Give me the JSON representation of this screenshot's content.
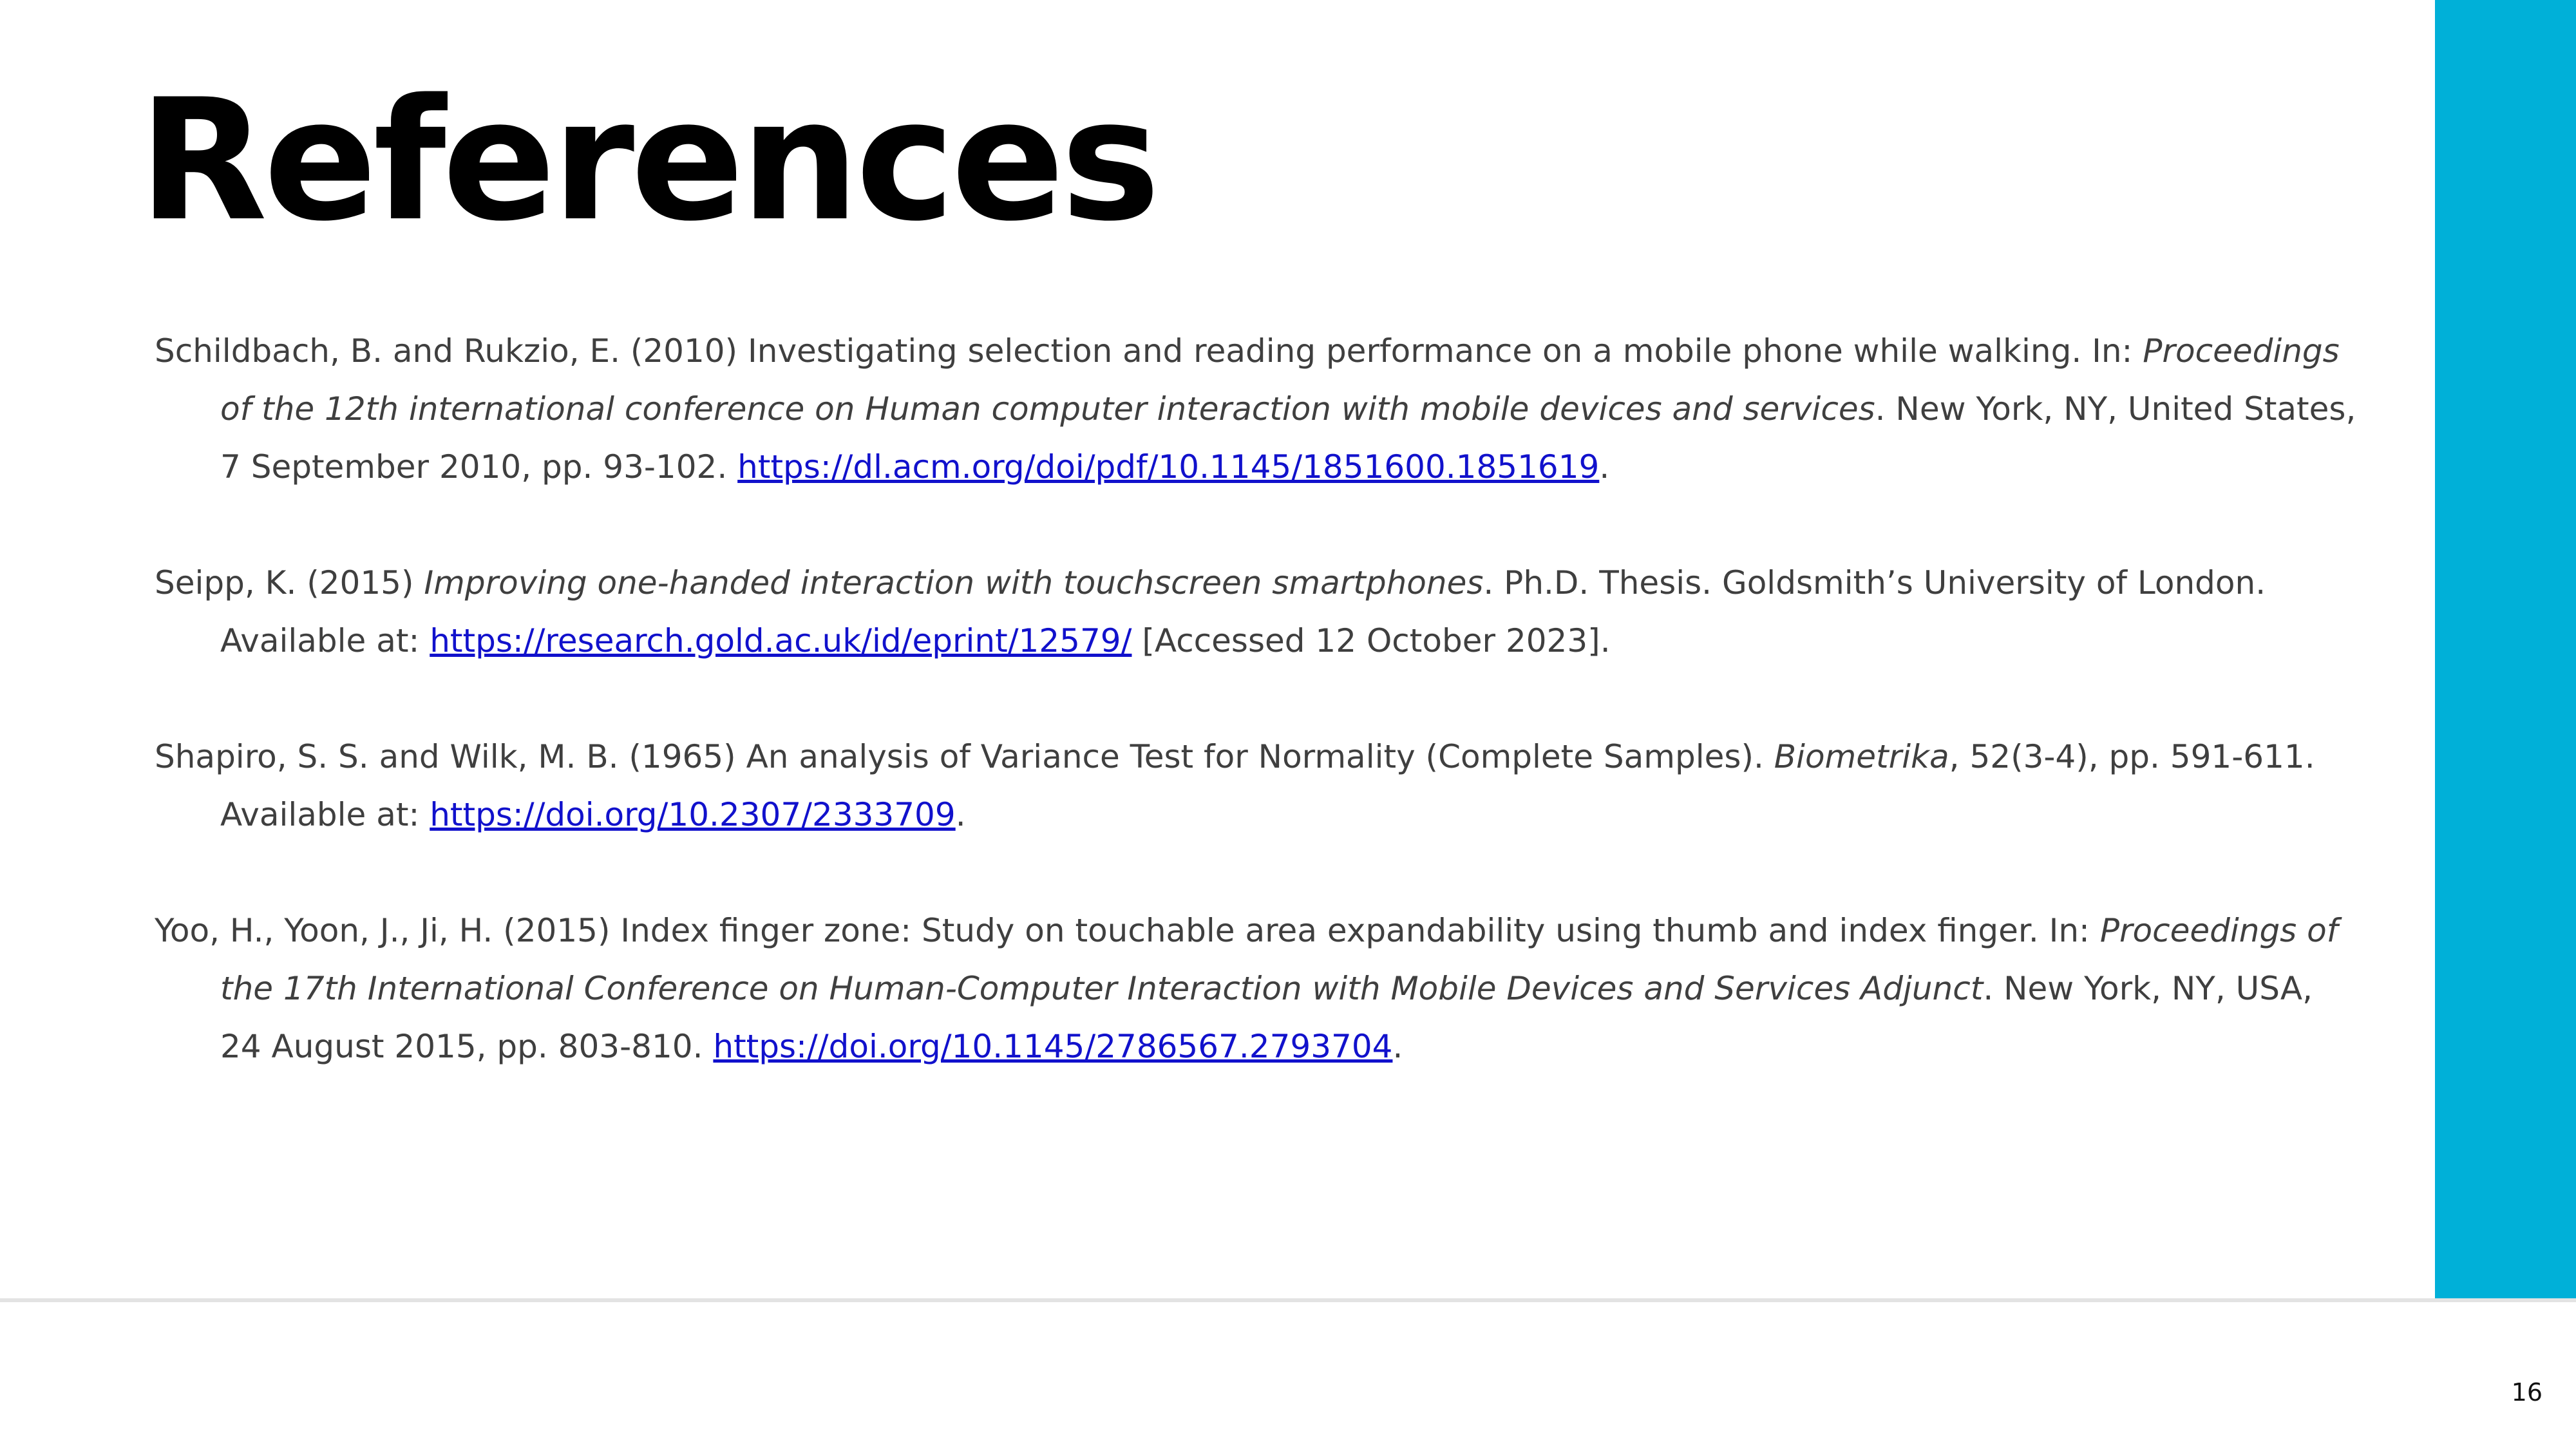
{
  "slide": {
    "title": "References",
    "page_number": "16",
    "accent_color": "#00b0d8"
  },
  "references": [
    {
      "plain1": "Schildbach, B. and Rukzio, E. (2010) Investigating selection and reading performance on a mobile phone while walking. In: ",
      "italic1": "Proceedings of the 12th international conference on Human computer interaction with mobile devices and services",
      "plain2": ". New York, NY, United States, 7 September 2010, pp. 93-102. ",
      "link": "https://dl.acm.org/doi/pdf/10.1145/1851600.1851619",
      "tail": "."
    },
    {
      "plain1": "Seipp, K. (2015) ",
      "italic1": "Improving one-handed interaction with touchscreen smartphones",
      "plain2": ". Ph.D. Thesis. Goldsmith’s University of London. Available at: ",
      "link": "https://research.gold.ac.uk/id/eprint/12579/",
      "tail": " [Accessed 12 October 2023]."
    },
    {
      "plain1": "Shapiro, S. S. and Wilk, M. B. (1965) An analysis of Variance Test for Normality (Complete Samples). ",
      "italic1": "Biometrika",
      "plain2": ", 52(3-4), pp. 591-611. Available at: ",
      "link": "https://doi.org/10.2307/2333709",
      "tail": "."
    },
    {
      "plain1": "Yoo, H., Yoon, J., Ji, H. (2015) Index finger zone: Study on touchable area expandability using thumb and index finger. In: ",
      "italic1": "Proceedings of the 17th International Conference on Human-Computer Interaction with Mobile Devices and Services Adjunct",
      "plain2": ". New York, NY, USA, 24 August 2015, pp. 803-810. ",
      "link": "https://doi.org/10.1145/2786567.2793704",
      "tail": "."
    }
  ]
}
